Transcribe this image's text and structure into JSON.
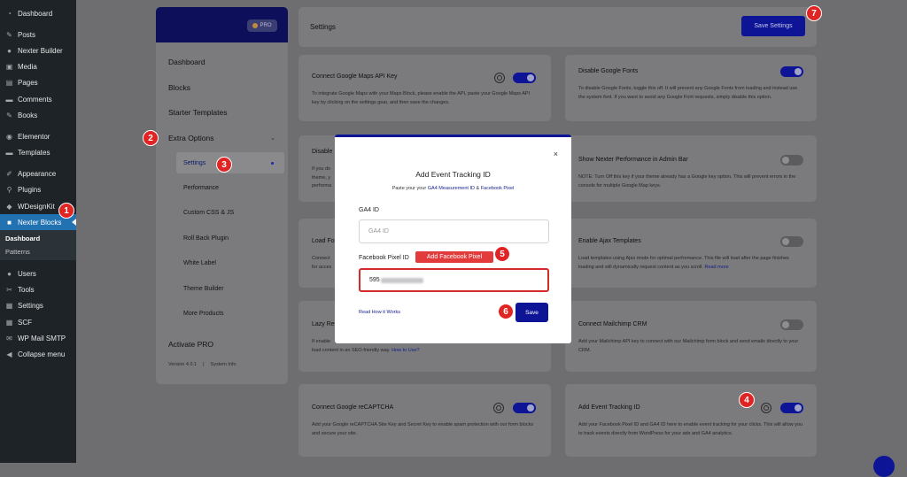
{
  "wp_menu": {
    "group1": [
      "Dashboard"
    ],
    "group2": [
      "Posts",
      "Nexter Builder",
      "Media",
      "Pages",
      "Comments",
      "Books"
    ],
    "group3": [
      "Elementor",
      "Templates"
    ],
    "group4": [
      "Appearance",
      "Plugins",
      "WDesignKit",
      "Nexter Blocks"
    ],
    "nexter_sub": [
      "Dashboard",
      "Patterns"
    ],
    "group5": [
      "Users",
      "Tools",
      "Settings",
      "SCF",
      "WP Mail SMTP",
      "Collapse menu"
    ]
  },
  "badges": {
    "b1": "1",
    "b2": "2",
    "b3": "3",
    "b4": "4",
    "b5": "5",
    "b6": "6",
    "b7": "7"
  },
  "nexter_panel": {
    "pro": "PRO",
    "menu": [
      "Dashboard",
      "Blocks",
      "Starter Templates",
      "Extra Options"
    ],
    "sub": [
      "Settings",
      "Performance",
      "Custom CSS & JS",
      "Roll Back Plugin",
      "White Label",
      "Theme Builder",
      "More Products"
    ],
    "activate": "Activate PRO",
    "version": "Version 4.0.1",
    "sep": "|",
    "system_info": "System Info"
  },
  "settings_bar": {
    "title": "Settings",
    "save": "Save Settings"
  },
  "cards": {
    "maps": {
      "title": "Connect Google Maps API Key",
      "desc": "To integrate Google Maps with your Maps Block, please enable the API, paste your Google Maps API key by clicking on the settings gear, and then save the changes."
    },
    "fonts": {
      "title": "Disable Google Fonts",
      "desc": "To disable Google Fonts, toggle this off. It will prevent any Google Fonts from loading and instead use the system font. If you want to avoid any Google Font requests, simply disable this option."
    },
    "disable": {
      "title": "Disable",
      "desc1": "If you do",
      "desc2": "theme, y",
      "desc3": "performa"
    },
    "perf": {
      "title": "Show Nexter Performance in Admin Bar",
      "desc": "NOTE: Turn Off this key if your theme already has a Google key option. This will prevent errors in the console for multiple Google Map keys."
    },
    "load": {
      "title": "Load Fo",
      "desc1": "Connect",
      "desc2": "for acces"
    },
    "ajax": {
      "title": "Enable Ajax Templates",
      "desc": "Load templates using Ajax mode for optimal performance. This file will load after the page finishes loading and will dynamically request content as you scroll.",
      "more": "Read more"
    },
    "lazy": {
      "title": "Lazy Re",
      "desc1": "If enable",
      "desc2": "load content in an SEO-friendly way.",
      "link": "How to Use?"
    },
    "mailchimp": {
      "title": "Connect Mailchimp CRM",
      "desc": "Add your Mailchimp API key to connect with our Mailchimp form block and send emails directly to your CRM."
    },
    "recaptcha": {
      "title": "Connect Google reCAPTCHA",
      "desc": "Add your Google reCAPTCHA Site Key and Secret Key to enable spam protection with our form blocks and secure your site."
    },
    "tracking": {
      "title": "Add Event Tracking ID",
      "desc": "Add your Facebook Pixel ID and GA4 ID here to enable event tracking for your clicks. This will allow you to track events directly from WordPress for your ads and GA4 analytics."
    }
  },
  "modal": {
    "close": "×",
    "title": "Add Event Tracking ID",
    "sub_prefix": "Paste your your",
    "sub_link1": "GA4 Measurement ID",
    "sub_amp": "&",
    "sub_link2": "Facebook Pixel",
    "ga4_label": "GA4 ID",
    "ga4_placeholder": "GA4 ID",
    "pixel_label": "Facebook Pixel ID",
    "pixel_value": "595",
    "callout": "Add Facebook Pixel",
    "how_link": "Read How it Works",
    "save": "Save"
  },
  "colors": {
    "brand": "#0d1596",
    "badge": "#e02424",
    "wp_active": "#2271b1"
  }
}
